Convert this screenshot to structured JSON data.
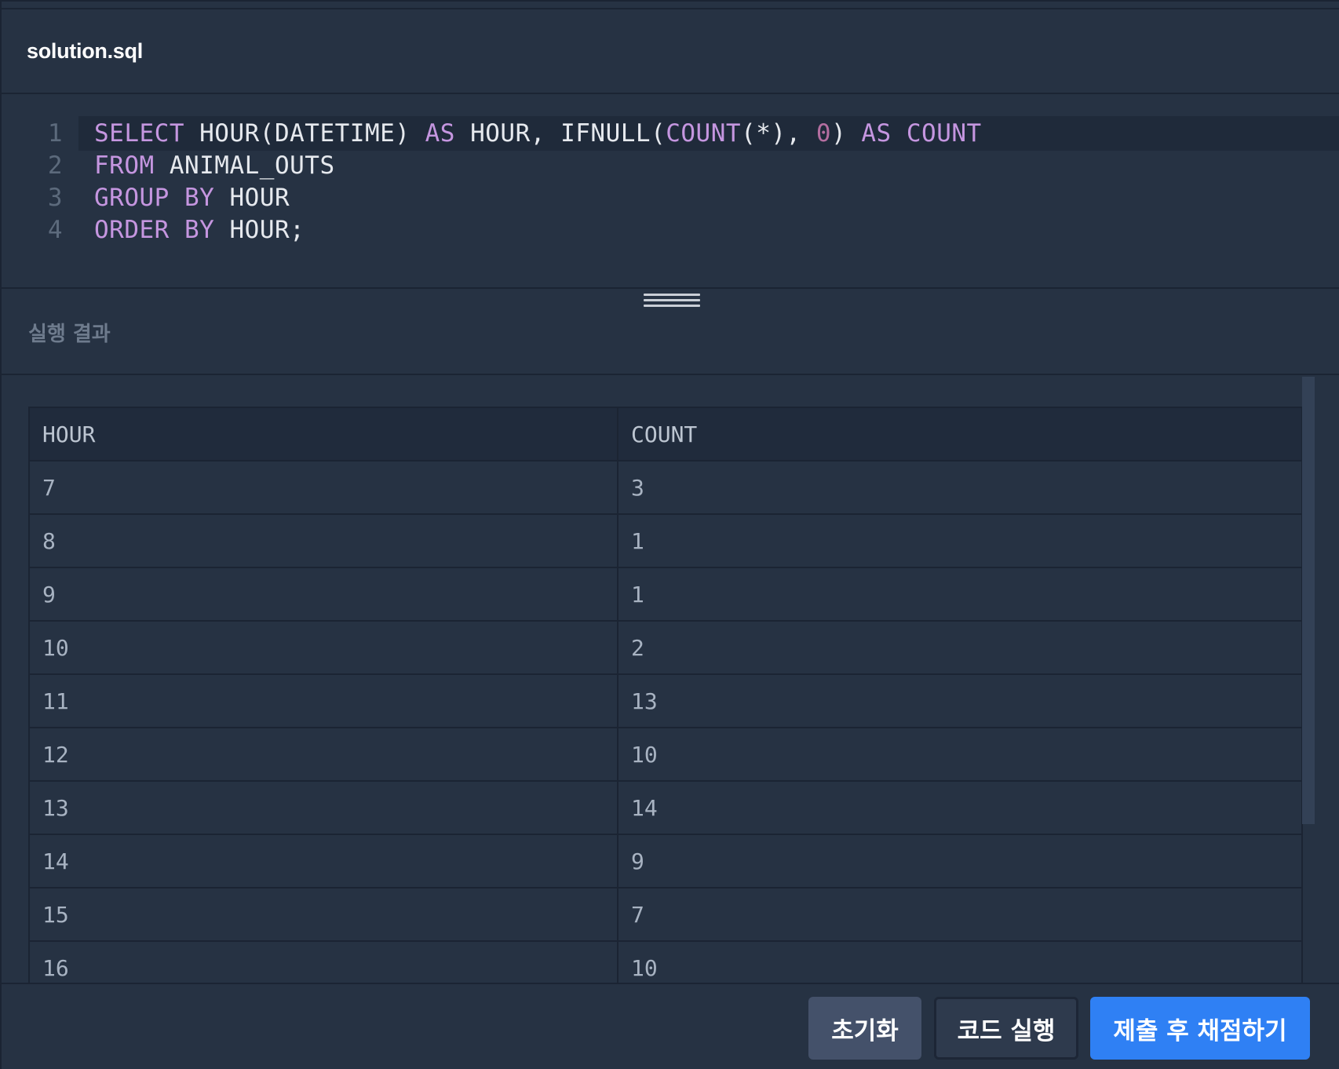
{
  "file": {
    "name": "solution.sql"
  },
  "editor": {
    "lines": [
      {
        "num": "1",
        "tokens": [
          {
            "t": "SELECT",
            "c": "kw"
          },
          {
            "t": " HOUR(DATETIME) ",
            "c": "plain"
          },
          {
            "t": "AS",
            "c": "kw"
          },
          {
            "t": " HOUR, IFNULL(",
            "c": "plain"
          },
          {
            "t": "COUNT",
            "c": "kw"
          },
          {
            "t": "(*), ",
            "c": "plain"
          },
          {
            "t": "0",
            "c": "num"
          },
          {
            "t": ") ",
            "c": "plain"
          },
          {
            "t": "AS",
            "c": "kw"
          },
          {
            "t": " ",
            "c": "plain"
          },
          {
            "t": "COUNT",
            "c": "kw"
          }
        ]
      },
      {
        "num": "2",
        "tokens": [
          {
            "t": "FROM",
            "c": "kw"
          },
          {
            "t": " ANIMAL_OUTS",
            "c": "plain"
          }
        ]
      },
      {
        "num": "3",
        "tokens": [
          {
            "t": "GROUP",
            "c": "kw"
          },
          {
            "t": " ",
            "c": "plain"
          },
          {
            "t": "BY",
            "c": "kw"
          },
          {
            "t": " HOUR",
            "c": "plain"
          }
        ]
      },
      {
        "num": "4",
        "tokens": [
          {
            "t": "ORDER",
            "c": "kw"
          },
          {
            "t": " ",
            "c": "plain"
          },
          {
            "t": "BY",
            "c": "kw"
          },
          {
            "t": " HOUR;",
            "c": "plain"
          }
        ]
      }
    ]
  },
  "result": {
    "title": "실행 결과",
    "columns": [
      "HOUR",
      "COUNT"
    ],
    "rows": [
      [
        "7",
        "3"
      ],
      [
        "8",
        "1"
      ],
      [
        "9",
        "1"
      ],
      [
        "10",
        "2"
      ],
      [
        "11",
        "13"
      ],
      [
        "12",
        "10"
      ],
      [
        "13",
        "14"
      ],
      [
        "14",
        "9"
      ],
      [
        "15",
        "7"
      ],
      [
        "16",
        "10"
      ]
    ]
  },
  "buttons": {
    "reset": "초기화",
    "run": "코드 실행",
    "submit": "제출 후 채점하기"
  },
  "colors": {
    "background": "#263243",
    "keyword": "#c596e0",
    "number": "#b46ea0",
    "primary": "#2f80f4"
  }
}
